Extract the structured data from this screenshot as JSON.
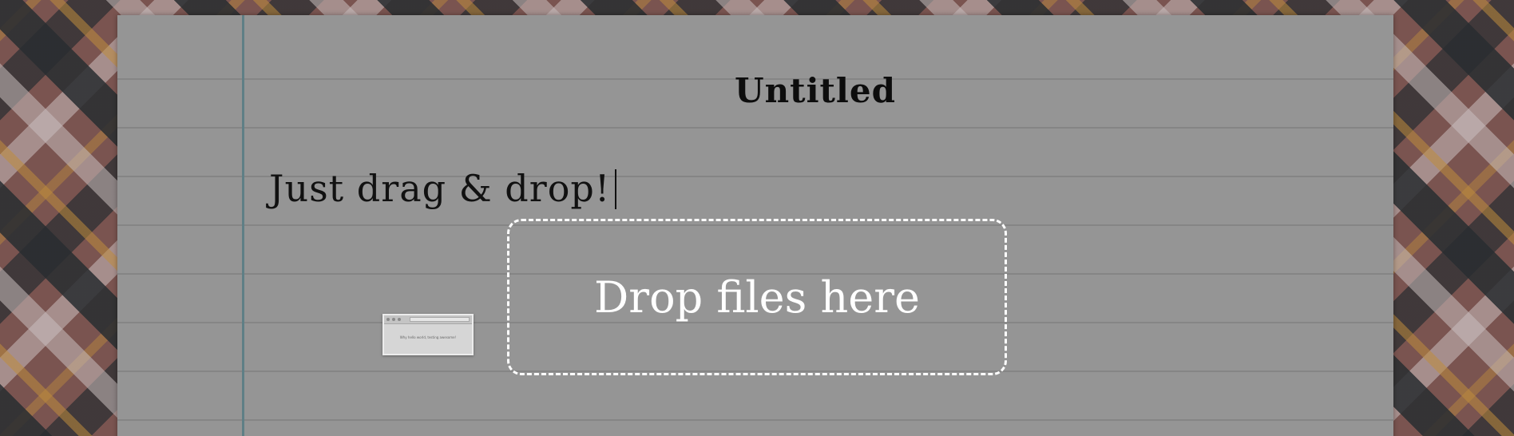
{
  "document": {
    "title": "Untitled",
    "body_text": "Just drag & drop!"
  },
  "drop_zone": {
    "label": "Drop files here"
  },
  "drag_preview": {
    "caption": "Why hello world, testing awesome!"
  },
  "colors": {
    "paper": "#959595",
    "margin_line": "#5f7f86",
    "drop_border": "#ffffff",
    "text": "#111111"
  }
}
